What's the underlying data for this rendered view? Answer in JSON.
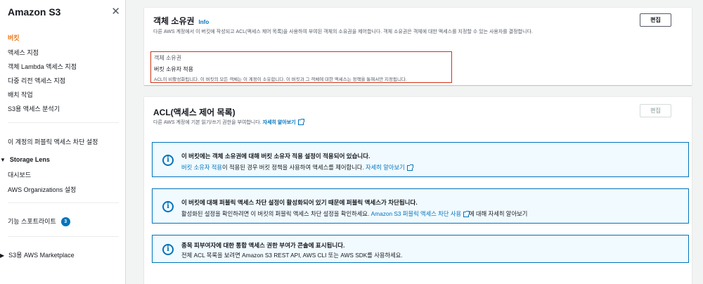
{
  "sidebar": {
    "title": "Amazon S3",
    "items": [
      {
        "label": "버킷"
      },
      {
        "label": "액세스 지점"
      },
      {
        "label": "객체 Lambda 액세스 지점"
      },
      {
        "label": "다중 리전 액세스 지점"
      },
      {
        "label": "배치 작업"
      },
      {
        "label": "S3용 액세스 분석기"
      }
    ],
    "block_public_access": "이 계정의 퍼블릭 액세스 차단 설정",
    "storage_lens": {
      "label": "Storage Lens",
      "items": [
        {
          "label": "대시보드"
        },
        {
          "label": "AWS Organizations 설정"
        }
      ]
    },
    "feature_spotlight": {
      "label": "기능 스포트라이트",
      "badge": "3"
    },
    "marketplace": "S3용 AWS Marketplace"
  },
  "ownership": {
    "title": "객체 소유권",
    "info": "Info",
    "edit": "편집",
    "description": "다른 AWS 계정에서 이 버킷에 작성되고 ACL(액세스 제어 목록)을 사용하여 부여된 객체의 소유권을 제어합니다. 객체 소유권은 객체에 대한 액세스를 지정할 수 있는 사용자를 결정합니다.",
    "field_label": "객체 소유권",
    "field_value": "버킷 소유자 적용",
    "field_desc": "ACL이 비활성화됩니다. 이 버킷의 모든 객체는 이 계정이 소유합니다. 이 버킷과 그 객체에 대한 액세스는 정책을 통해서만 지정됩니다."
  },
  "acl": {
    "title": "ACL(액세스 제어 목록)",
    "edit": "편집",
    "desc_prefix": "다른 AWS 계정에 기본 읽기/쓰기 권한을 부여합니다.",
    "learn_more": "자세히 알아보기",
    "alerts": [
      {
        "title": "이 버킷에는 객체 소유권에 대해 버킷 소유자 적용 설정이 적용되어 있습니다.",
        "link": "버킷 소유자 적용",
        "body": "이 적용된 경우 버킷 정책을 사용하여 액세스를 제어합니다.",
        "learn_more": "자세히 알아보기"
      },
      {
        "title": "이 버킷에 대해 퍼블릭 액세스 차단 설정이 활성화되어 있기 때문에 퍼블릭 액세스가 차단됩니다.",
        "body_prefix": "활성화된 설정을 확인하려면 이 버킷의 퍼블릭 액세스 차단 설정을 확인하세요.",
        "link": "Amazon S3 퍼블릭 액세스 차단 사용",
        "body_suffix": "에 대해 자세히 알아보기"
      },
      {
        "title": "종목 피부여자에 대한 통합 액세스 권한 부여가 콘솔에 표시됩니다.",
        "body": "전체 ACL 목록을 보려면 Amazon S3 REST API, AWS CLI 또는 AWS SDK를 사용하세요."
      }
    ]
  },
  "colors": {
    "accent": "#ec7211",
    "link": "#0073bb",
    "alert_bg": "#f1faff",
    "highlight": "#d13212"
  }
}
